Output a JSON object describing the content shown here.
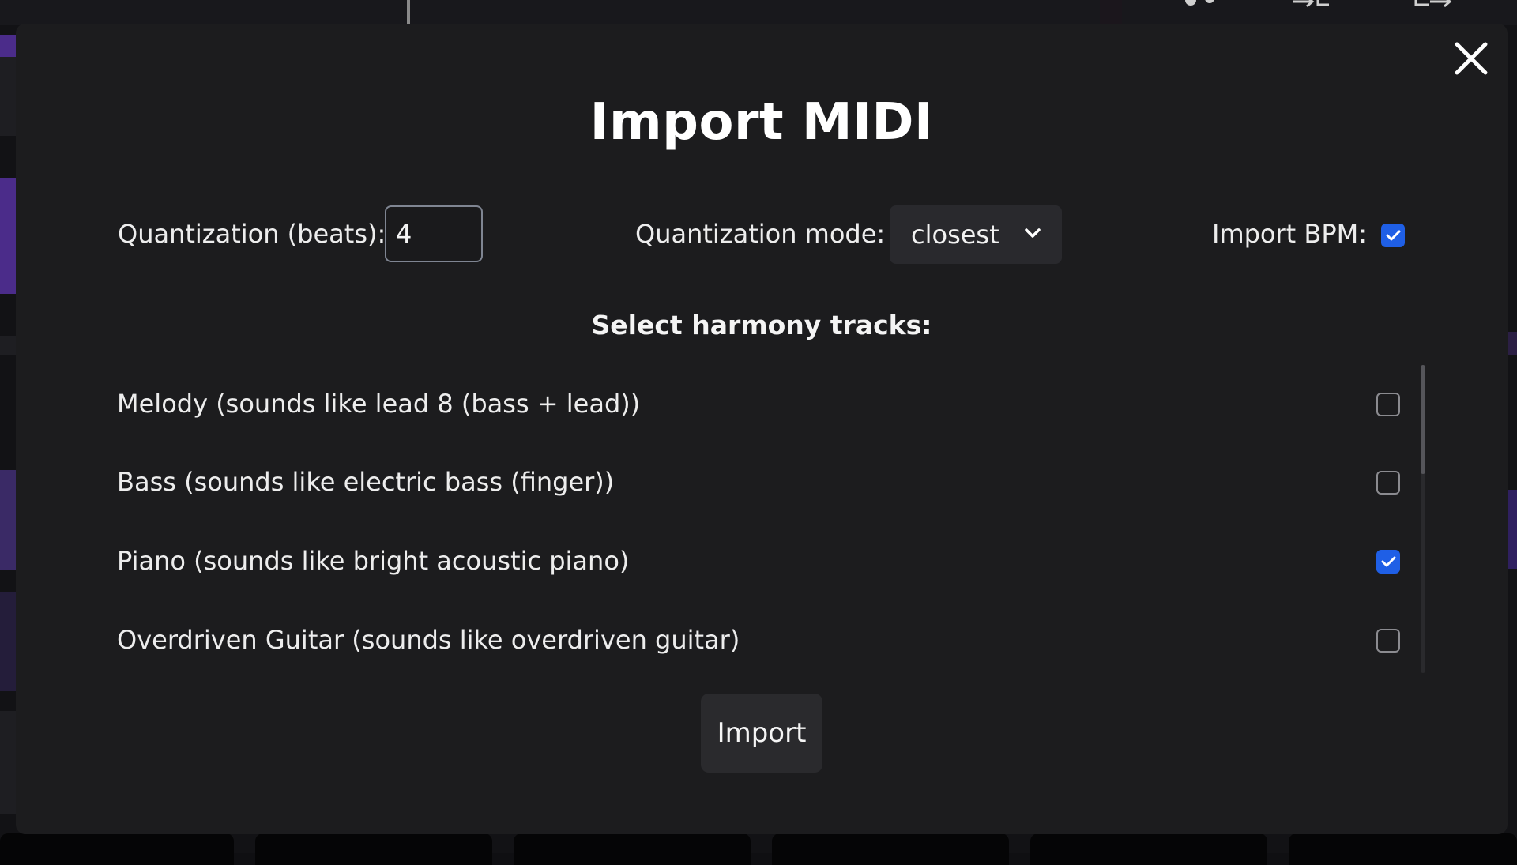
{
  "modal": {
    "title": "Import MIDI",
    "quantization_beats_label": "Quantization (beats):",
    "quantization_beats_value": "4",
    "quantization_mode_label": "Quantization mode:",
    "quantization_mode_value": "closest",
    "import_bpm_label": "Import BPM:",
    "import_bpm_checked": true,
    "tracks_heading": "Select harmony tracks:",
    "tracks": [
      {
        "label": "Melody (sounds like lead 8 (bass + lead))",
        "checked": false
      },
      {
        "label": "Bass (sounds like electric bass (finger))",
        "checked": false
      },
      {
        "label": "Piano (sounds like bright acoustic piano)",
        "checked": true
      },
      {
        "label": "Overdriven Guitar (sounds like overdriven guitar)",
        "checked": false
      }
    ],
    "import_button": "Import"
  },
  "colors": {
    "modal_bg": "#1c1c1e",
    "checkbox_checked": "#1f5fe6",
    "button_bg": "#2a2a2d"
  },
  "icons": {
    "close": "close-icon",
    "dropdown": "chevron-down-icon",
    "check": "checkmark-icon"
  }
}
